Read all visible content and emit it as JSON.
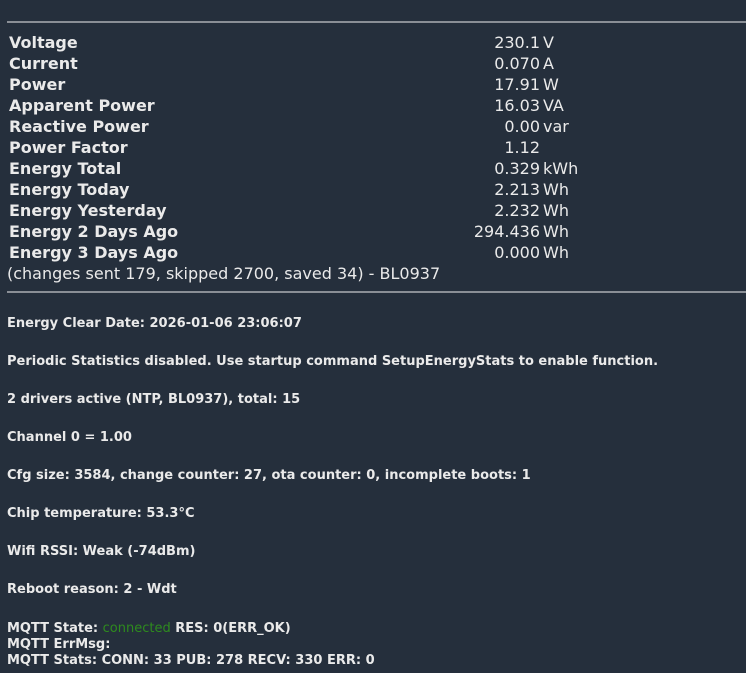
{
  "measurements": [
    {
      "label": "Voltage",
      "value": "230.1",
      "unit": "V"
    },
    {
      "label": "Current",
      "value": "0.070",
      "unit": "A"
    },
    {
      "label": "Power",
      "value": "17.91",
      "unit": "W"
    },
    {
      "label": "Apparent Power",
      "value": "16.03",
      "unit": "VA"
    },
    {
      "label": "Reactive Power",
      "value": "0.00",
      "unit": "var"
    },
    {
      "label": "Power Factor",
      "value": "1.12",
      "unit": ""
    },
    {
      "label": "Energy Total",
      "value": "0.329",
      "unit": "kWh"
    },
    {
      "label": "Energy Today",
      "value": "2.213",
      "unit": "Wh"
    },
    {
      "label": "Energy Yesterday",
      "value": "2.232",
      "unit": "Wh"
    },
    {
      "label": "Energy 2 Days Ago",
      "value": "294.436",
      "unit": "Wh"
    },
    {
      "label": "Energy 3 Days Ago",
      "value": "0.000",
      "unit": "Wh"
    }
  ],
  "changes_note": "(changes sent 179, skipped 2700, saved 34) - BL0937",
  "info": {
    "clear_date": "Energy Clear Date: 2026-01-06 23:06:07",
    "periodic": "Periodic Statistics disabled. Use startup command SetupEnergyStats to enable function.",
    "drivers": "2 drivers active (NTP, BL0937), total: 15",
    "channel": "Channel 0 = 1.00",
    "cfg": "Cfg size: 3584, change counter: 27, ota counter: 0, incomplete boots: 1",
    "chip_temp": "Chip temperature: 53.3°C",
    "wifi": "Wifi RSSI: Weak (-74dBm)",
    "reboot": "Reboot reason: 2 - Wdt",
    "mqtt_state_prefix": "MQTT State: ",
    "mqtt_state": "connected",
    "mqtt_res": " RES: 0(ERR_OK)",
    "mqtt_errmsg": "MQTT ErrMsg:",
    "mqtt_stats": "MQTT Stats: CONN: 33 PUB: 278 RECV: 330 ERR: 0"
  },
  "colors": {
    "background": "#252f3c",
    "connected": "#2e8b1e"
  }
}
